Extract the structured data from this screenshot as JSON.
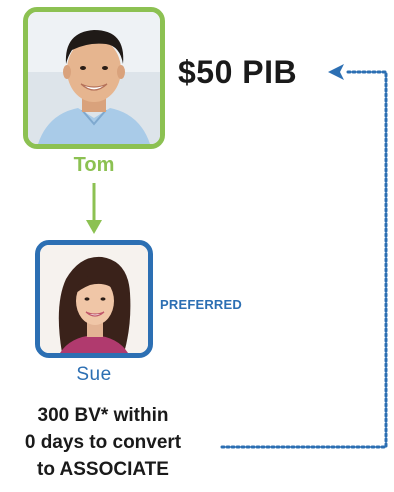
{
  "people": {
    "upline": {
      "name": "Tom"
    },
    "downline": {
      "name": "Sue",
      "status": "PREFERRED"
    }
  },
  "reward": {
    "label": "$50 PIB"
  },
  "condition": {
    "lines": [
      "300 BV* within",
      "0 days to convert",
      "to ASSOCIATE"
    ]
  },
  "colors": {
    "tom_green": "#8cc152",
    "sue_blue": "#2c6fb3",
    "arrow_blue": "#2c6fb3"
  }
}
